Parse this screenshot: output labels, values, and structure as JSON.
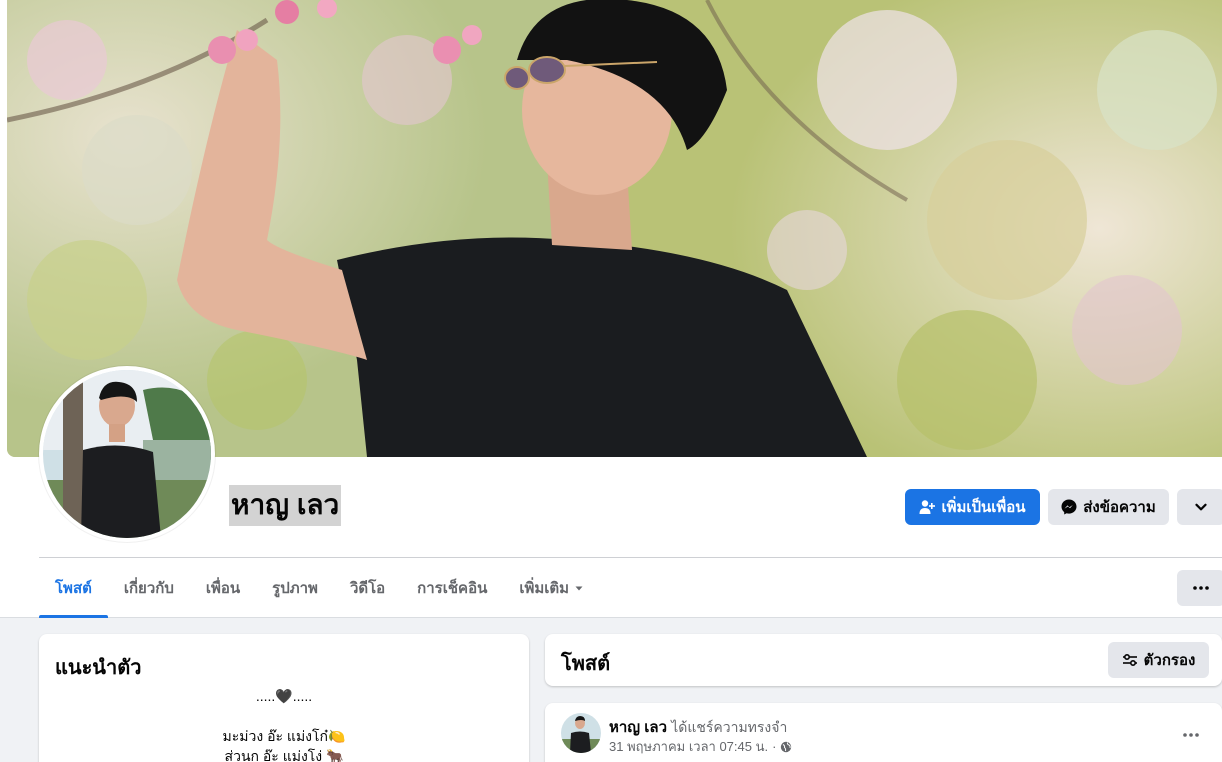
{
  "profile": {
    "name": "หาญ เลว"
  },
  "actions": {
    "add_friend": "เพิ่มเป็นเพื่อน",
    "message": "ส่งข้อความ"
  },
  "tabs": [
    {
      "label": "โพสต์",
      "active": true
    },
    {
      "label": "เกี่ยวกับ"
    },
    {
      "label": "เพื่อน"
    },
    {
      "label": "รูปภาพ"
    },
    {
      "label": "วิดีโอ"
    },
    {
      "label": "การเช็คอิน"
    },
    {
      "label": "เพิ่มเติม"
    }
  ],
  "intro": {
    "title": "แนะนำตัว",
    "bio_lines": [
      ".....🖤.....",
      "มะม่วง อ๊ะ แม่งโก๋🍋",
      "ส่วนก อ๊ะ แม่งโง่ 🐂"
    ]
  },
  "posts_section": {
    "title": "โพสต์",
    "filter_label": "ตัวกรอง"
  },
  "post": {
    "author": "หาญ เลว",
    "action": "ได้แชร์ความทรงจำ",
    "timestamp": "31 พฤษภาคม เวลา 07:45 น.",
    "separator": "·"
  },
  "colors": {
    "accent": "#1b74e4",
    "background": "#f0f2f5",
    "secondary_button": "#e4e6eb"
  }
}
